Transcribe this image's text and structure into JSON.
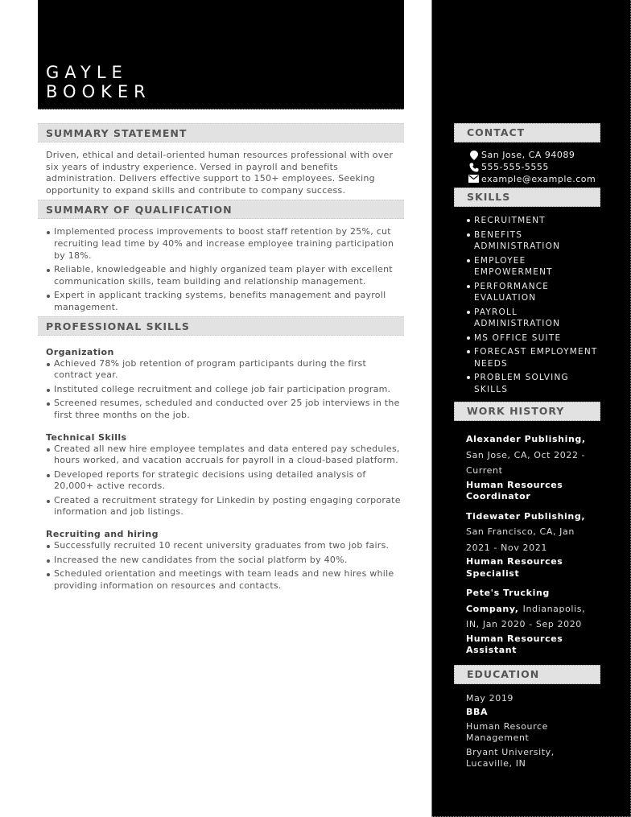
{
  "name": {
    "first": "GAYLE",
    "last": "BOOKER"
  },
  "summary": {
    "heading": "SUMMARY STATEMENT",
    "text": "Driven, ethical and detail-oriented human resources professional with over six years of industry experience. Versed in payroll and benefits administration. Delivers effective support to 150+ employees. Seeking opportunity to expand skills and contribute to company success."
  },
  "qualification": {
    "heading": "SUMMARY OF QUALIFICATION",
    "items": [
      "Implemented process improvements to boost staff retention by 25%, cut recruiting lead time by 40% and increase employee training participation by 18%.",
      "Reliable, knowledgeable and highly organized team player with excellent communication skills, team building and relationship management.",
      "Expert in applicant tracking systems, benefits management and payroll management."
    ]
  },
  "professional_skills": {
    "heading": "PROFESSIONAL SKILLS",
    "groups": [
      {
        "title": "Organization",
        "items": [
          "Achieved 78% job retention of program participants during the first contract year.",
          "Instituted college recruitment and college job fair participation program.",
          "Screened resumes, scheduled and conducted over 25 job interviews in the first three months on the job."
        ]
      },
      {
        "title": "Technical Skills",
        "items": [
          "Created all new hire employee templates and data entered pay schedules, hours worked, and vacation accruals for payroll in a cloud-based platform.",
          "Developed reports for strategic decisions using detailed analysis of 20,000+ active records.",
          "Created a recruitment strategy for Linkedin by posting engaging corporate information and job listings."
        ]
      },
      {
        "title": "Recruiting and hiring",
        "items": [
          "Successfully recruited 10 recent university graduates from two job fairs.",
          "Increased the new candidates from the social platform by 40%.",
          "Scheduled orientation and meetings with team leads and new hires while providing information on resources and contacts."
        ]
      }
    ]
  },
  "contact": {
    "heading": "CONTACT",
    "items": [
      {
        "icon": "map-pin-icon",
        "text": "San Jose, CA 94089"
      },
      {
        "icon": "phone-icon",
        "text": "555-555-5555"
      },
      {
        "icon": "envelope-icon",
        "text": "example@example.com"
      }
    ]
  },
  "skills": {
    "heading": "SKILLS",
    "items": [
      "RECRUITMENT",
      "BENEFITS ADMINISTRATION",
      "EMPLOYEE EMPOWERMENT",
      "PERFORMANCE EVALUATION",
      "PAYROLL ADMINISTRATION",
      "MS OFFICE SUITE",
      "FORECAST EMPLOYMENT NEEDS",
      "PROBLEM SOLVING SKILLS"
    ]
  },
  "work_history": {
    "heading": "WORK HISTORY",
    "jobs": [
      {
        "company": "Alexander Publishing,",
        "location": "San Jose, CA, Oct 2022 - Current",
        "title": "Human Resources Coordinator"
      },
      {
        "company": "Tidewater Publishing,",
        "location": "San Francisco, CA, Jan 2021 - Nov 2021",
        "title": "Human Resources Specialist"
      },
      {
        "company": "Pete's Trucking Company,",
        "location": "Indianapolis, IN, Jan 2020 - Sep 2020",
        "title": "Human Resources Assistant"
      }
    ]
  },
  "education": {
    "heading": "EDUCATION",
    "date": "May 2019",
    "degree": "BBA",
    "field": "Human Resource Management",
    "school": "Bryant University, Lucaville, IN"
  }
}
